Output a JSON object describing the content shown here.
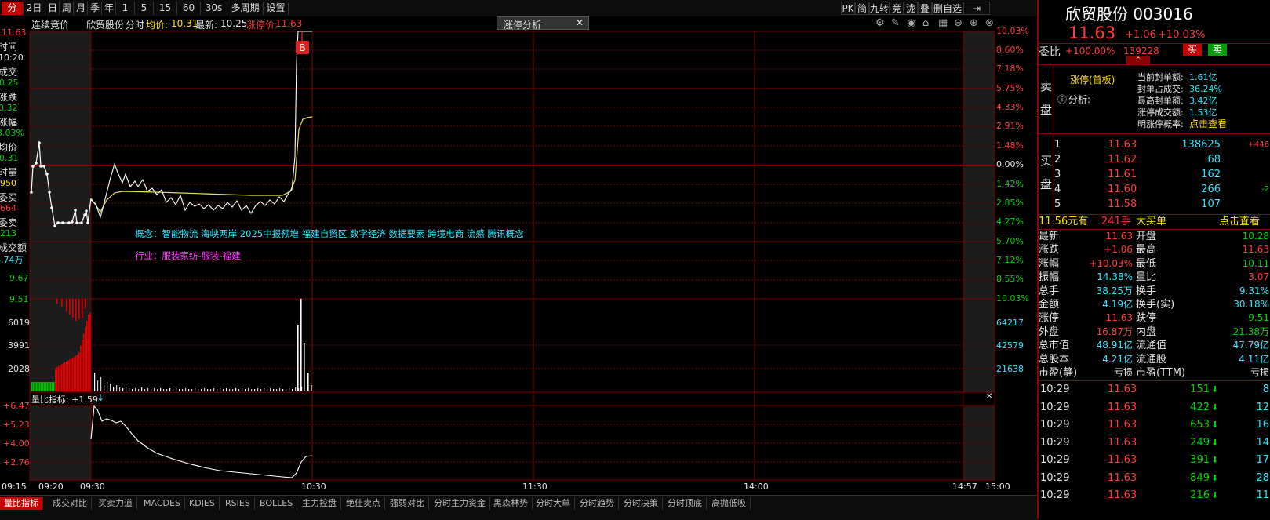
{
  "toolbar": {
    "items": [
      "分时",
      "2日",
      "日",
      "周",
      "月",
      "季",
      "年",
      "1分",
      "5分",
      "15分",
      "60分",
      "30s",
      "多周期",
      "设置"
    ],
    "right": [
      "PK",
      "简",
      "九转",
      "竞",
      "泷",
      "叠",
      "删自选",
      "⇥"
    ]
  },
  "chart": {
    "header": {
      "auction_label": "连续竞价",
      "stock_name": "欣贸股份",
      "mode": "分时",
      "avg_label": "均价:",
      "avg_value": "10.31",
      "latest_label": "最新:",
      "latest_value": "10.25",
      "limit_label": "涨停价:",
      "limit_value": "11.63"
    },
    "analysis_tab": "涨停分析",
    "marker": "B",
    "left_info": {
      "top_price": "11.63",
      "time_label": "时间",
      "time_value": "10:20",
      "trade_label": "成交",
      "trade_value": "10.25",
      "chg_label": "涨跌",
      "chg_value": "-0.32",
      "pct_label": "涨幅",
      "pct_value": "-3.03%",
      "avg_label": "均价",
      "avg_value": "10.31",
      "vol_label": "时量",
      "vol_value": "950",
      "bid_label": "委买",
      "bid_value": "664",
      "ask_label": "委卖",
      "ask_value": "213",
      "amt_label": "成交额",
      "amt_value": "4.74万",
      "low_price": "9.67",
      "vol_top_price": "9.51"
    },
    "pct_axis": [
      "10.03%",
      "8.60%",
      "7.18%",
      "5.75%",
      "4.33%",
      "2.91%",
      "1.48%",
      "0.00%",
      "1.42%",
      "2.85%",
      "4.27%",
      "5.70%",
      "7.12%",
      "8.55%",
      "10.03%"
    ],
    "vol_axis_left": [
      "6019",
      "3991",
      "2028"
    ],
    "vol_axis_right": [
      "64217",
      "42579",
      "21638"
    ],
    "ind_axis": [
      "+6.47",
      "+5.23",
      "+4.00",
      "+2.76"
    ],
    "indicator_label": "量比指标: +1.59",
    "concept": "概念：智能物流  海峡两岸  2025中报预增  福建自贸区  数字经济  数据要素  跨境电商  流感  腾讯概念",
    "industry": "行业：服装家纺-服装-福建",
    "time_axis": [
      "09:15",
      "09:20",
      "09:30",
      "10:30",
      "11:30",
      "14:00",
      "14:57",
      "15:00"
    ]
  },
  "bottom_tabs": [
    "量比指标",
    "成交对比",
    "买卖力道",
    "MACDES",
    "KDJES",
    "RSIES",
    "BOLLES",
    "主力控盘",
    "绝佳卖点",
    "强弱对比",
    "分时主力资金",
    "黑森林势",
    "分时大单",
    "分时趋势",
    "分时决策",
    "分时顶底",
    "高抛低吸"
  ],
  "panel": {
    "title": "欣贸股份 003016",
    "price": "11.63",
    "change": "+1.06",
    "pct": "+10.03%",
    "webi_label": "委比",
    "webi_value": "+100.00%",
    "webi_vol": "139228",
    "buy_btn": "买",
    "sell_btn": "卖",
    "sell_side_label": "卖盘",
    "limit_status": "涨停(首板)",
    "analysis": "分析:-",
    "seal_stats": [
      {
        "label": "当前封单额:",
        "value": "1.61亿"
      },
      {
        "label": "封单占成交:",
        "value": "36.24%"
      },
      {
        "label": "最高封单额:",
        "value": "3.42亿"
      },
      {
        "label": "涨停成交额:",
        "value": "1.53亿"
      },
      {
        "label": "明涨停概率:",
        "value": "点击查看"
      }
    ],
    "buy_side_label": "买盘",
    "bids": [
      {
        "level": "1",
        "price": "11.63",
        "vol": "138625",
        "chg": "+446"
      },
      {
        "level": "2",
        "price": "11.62",
        "vol": "68",
        "chg": ""
      },
      {
        "level": "3",
        "price": "11.61",
        "vol": "162",
        "chg": ""
      },
      {
        "level": "4",
        "price": "11.60",
        "vol": "266",
        "chg": "-2"
      },
      {
        "level": "5",
        "price": "11.58",
        "vol": "107",
        "chg": ""
      }
    ],
    "bigorder": {
      "price": "11.56元有",
      "lots": "241手",
      "label": "大买单",
      "link": "点击查看"
    },
    "stats": [
      [
        "最新",
        "11.63",
        "red",
        "开盘",
        "10.28",
        "grn"
      ],
      [
        "涨跌",
        "+1.06",
        "red",
        "最高",
        "11.63",
        "red"
      ],
      [
        "涨幅",
        "+10.03%",
        "red",
        "最低",
        "10.11",
        "grn"
      ],
      [
        "振幅",
        "14.38%",
        "cyn",
        "量比",
        "3.07",
        "red"
      ],
      [
        "总手",
        "38.25万",
        "cyn",
        "换手",
        "9.31%",
        "cyn"
      ],
      [
        "金额",
        "4.19亿",
        "cyn",
        "换手(实)",
        "30.18%",
        "cyn"
      ],
      [
        "涨停",
        "11.63",
        "red",
        "跌停",
        "9.51",
        "grn"
      ],
      [
        "外盘",
        "16.87万",
        "red",
        "内盘",
        "21.38万",
        "grn"
      ],
      [
        "总市值",
        "48.91亿",
        "cyn",
        "流通值",
        "47.79亿",
        "cyn"
      ],
      [
        "总股本",
        "4.21亿",
        "cyn",
        "流通股",
        "4.11亿",
        "cyn"
      ],
      [
        "市盈(静)",
        "亏损",
        "wht",
        "市盈(TTM)",
        "亏损",
        "wht"
      ]
    ],
    "ticks": [
      {
        "time": "10:29",
        "price": "11.63",
        "vol": "151",
        "n": "8"
      },
      {
        "time": "10:29",
        "price": "11.63",
        "vol": "422",
        "n": "12"
      },
      {
        "time": "10:29",
        "price": "11.63",
        "vol": "653",
        "n": "16"
      },
      {
        "time": "10:29",
        "price": "11.63",
        "vol": "249",
        "n": "14"
      },
      {
        "time": "10:29",
        "price": "11.63",
        "vol": "391",
        "n": "17"
      },
      {
        "time": "10:29",
        "price": "11.63",
        "vol": "849",
        "n": "28"
      },
      {
        "time": "10:29",
        "price": "11.63",
        "vol": "216",
        "n": "11"
      }
    ]
  }
}
